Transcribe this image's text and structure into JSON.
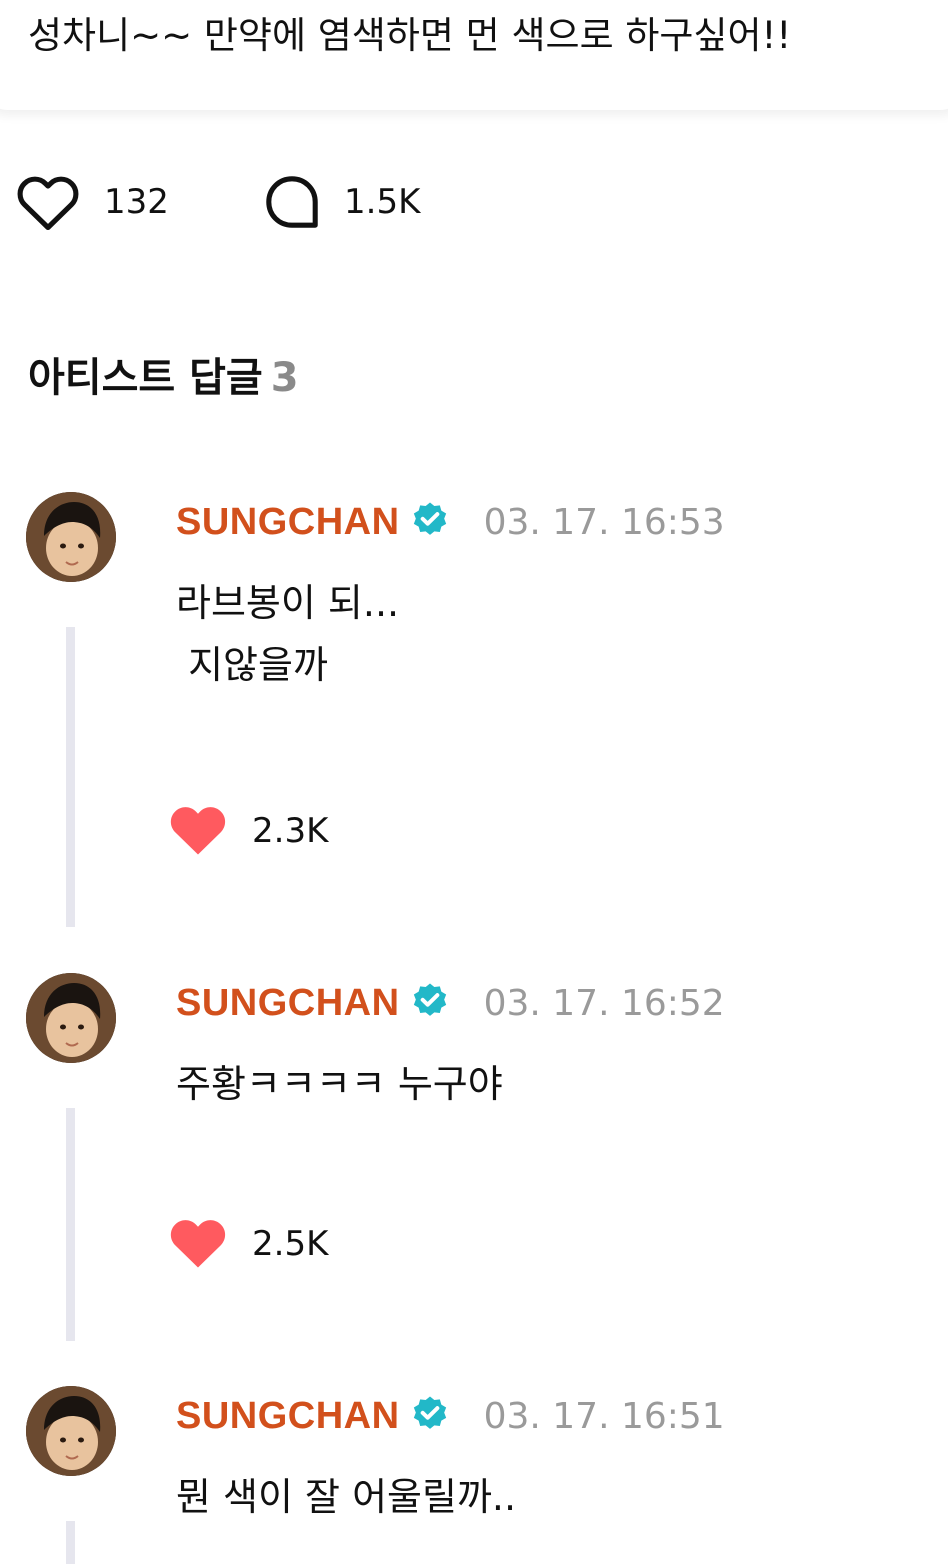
{
  "post": {
    "text": "성차니~~ 만약에 염색하면 먼 색으로 하구싶어!!"
  },
  "actions": {
    "like_count": "132",
    "comment_count": "1.5K"
  },
  "section": {
    "title": "아티스트 답글",
    "count": "3"
  },
  "theme": {
    "author_color": "#d2501c",
    "verified_color": "#22b8c8",
    "heart_color": "#ff5a5f",
    "thread_line_color": "#e6e6ee",
    "timestamp_color": "#9a9a9a"
  },
  "replies": [
    {
      "author": "SUNGCHAN",
      "timestamp": "03. 17. 16:53",
      "lines": [
        "라브봉이 되...",
        " 지않을까"
      ],
      "likes": "2.3K"
    },
    {
      "author": "SUNGCHAN",
      "timestamp": "03. 17. 16:52",
      "lines": [
        "주황ㅋㅋㅋㅋ 누구야"
      ],
      "likes": "2.5K"
    },
    {
      "author": "SUNGCHAN",
      "timestamp": "03. 17. 16:51",
      "lines": [
        "뭔 색이 잘 어울릴까.."
      ],
      "likes": ""
    }
  ]
}
